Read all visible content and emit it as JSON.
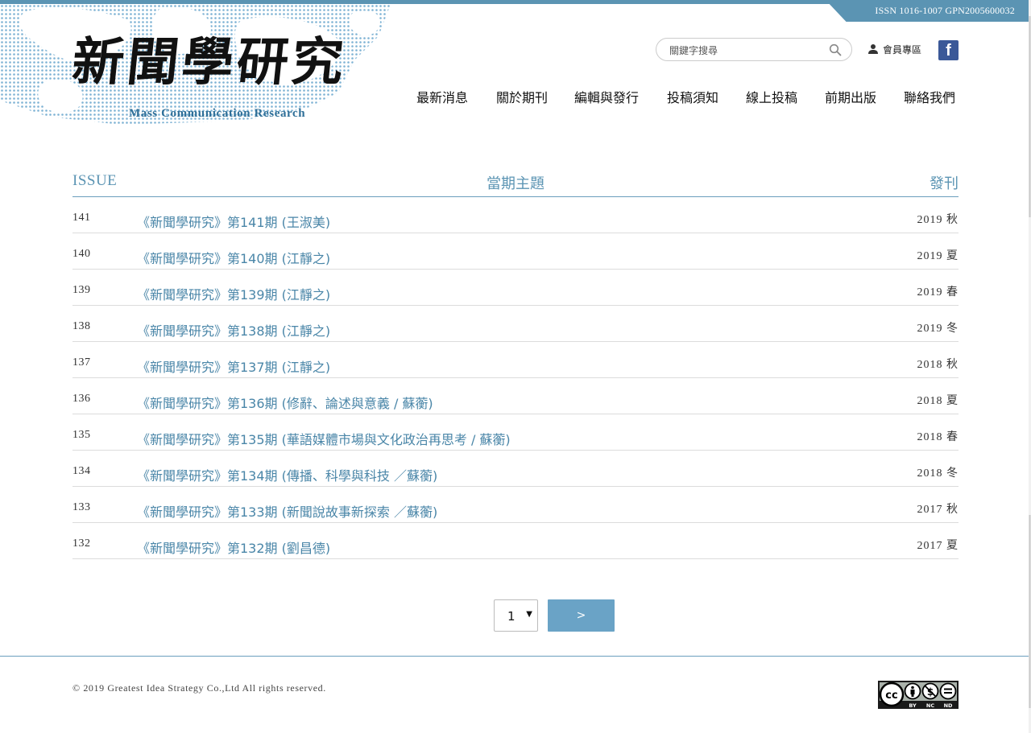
{
  "header": {
    "issn": "ISSN 1016-1007 GPN2005600032",
    "logo_title": "新聞學研究",
    "logo_subtitle": "Mass Communication Research",
    "search_placeholder": "關鍵字搜尋",
    "member_label": "會員專區",
    "facebook_label": "f"
  },
  "nav": {
    "items": [
      "最新消息",
      "關於期刊",
      "編輯與發行",
      "投稿須知",
      "線上投稿",
      "前期出版",
      "聯絡我們"
    ]
  },
  "table": {
    "headers": {
      "issue": "ISSUE",
      "theme": "當期主題",
      "published": "發刊"
    },
    "rows": [
      {
        "num": "141",
        "title": "《新聞學研究》第141期 (王淑美)",
        "date": "2019 秋"
      },
      {
        "num": "140",
        "title": "《新聞學研究》第140期 (江靜之)",
        "date": "2019 夏"
      },
      {
        "num": "139",
        "title": "《新聞學研究》第139期 (江靜之)",
        "date": "2019 春"
      },
      {
        "num": "138",
        "title": "《新聞學研究》第138期 (江靜之)",
        "date": "2019 冬"
      },
      {
        "num": "137",
        "title": "《新聞學研究》第137期 (江靜之)",
        "date": "2018 秋"
      },
      {
        "num": "136",
        "title": "《新聞學研究》第136期 (修辭、論述與意義 / 蘇蘅)",
        "date": "2018 夏"
      },
      {
        "num": "135",
        "title": "《新聞學研究》第135期 (華語媒體市場與文化政治再思考 / 蘇蘅)",
        "date": "2018 春"
      },
      {
        "num": "134",
        "title": "《新聞學研究》第134期 (傳播、科學與科技 ／蘇蘅)",
        "date": "2018 冬"
      },
      {
        "num": "133",
        "title": "《新聞學研究》第133期 (新聞說故事新探索 ／蘇蘅)",
        "date": "2017 秋"
      },
      {
        "num": "132",
        "title": "《新聞學研究》第132期 (劉昌德)",
        "date": "2017 夏"
      }
    ]
  },
  "pagination": {
    "page_value": "1",
    "next_label": ">"
  },
  "footer": {
    "copyright": "© 2019 Greatest Idea Strategy Co.,Ltd All rights reserved.",
    "license_badge": {
      "cc": "cc",
      "by": "BY",
      "nc": "NC",
      "nd": "ND"
    }
  },
  "colors": {
    "accent": "#5b94b3",
    "link": "#4a86a8",
    "button": "#6aa3c6",
    "facebook": "#3b5998"
  }
}
